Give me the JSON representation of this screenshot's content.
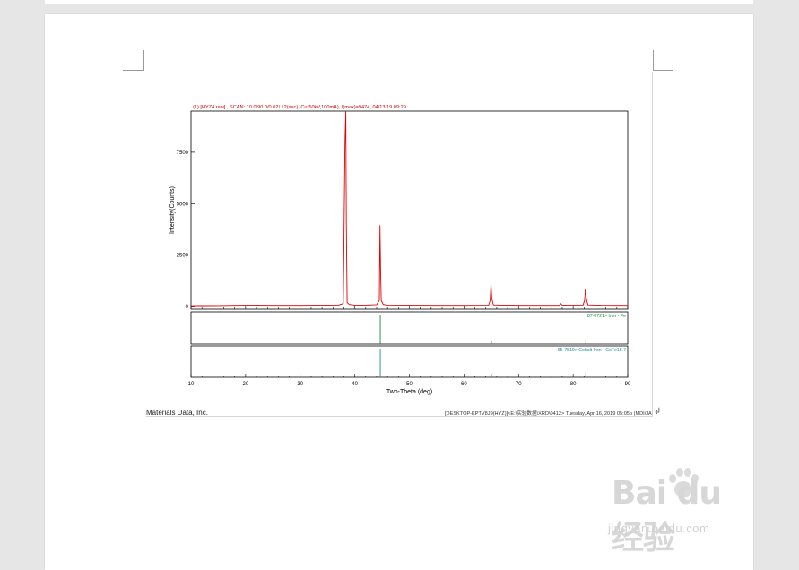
{
  "document": {
    "footer_left": "Materials Data, Inc.",
    "footer_right": "[DESKTOP-KPTV8J9(HYZ)]<E:\\实验数据\\XRD\\0412> Tuesday, Apr 16, 2019 05:05p (MDI/JA",
    "paragraph_mark": "↲"
  },
  "watermark": {
    "logo": "Bai du 经验",
    "url": "jingyan.baidu.com"
  },
  "chart_data": {
    "type": "line",
    "title": "(1) [HYZ4.raw] , SCAN: 10.0/90.0/0.02/.12(sec), Cu(50kV,100mA), I(max)=9474, 04/13/19 09:29",
    "xlabel": "Two-Theta (deg)",
    "ylabel": "Intensity(Counts)",
    "xlim": [
      10,
      90
    ],
    "ylim": [
      0,
      9500
    ],
    "xticks": [
      10,
      20,
      30,
      40,
      50,
      60,
      70,
      80,
      90
    ],
    "yticks": [
      0,
      2500,
      5000,
      7500
    ],
    "ytick_labels": [
      "0",
      "2500",
      "5000",
      "7500"
    ],
    "series": [
      {
        "color": "#e00000",
        "x": [
          10,
          12,
          15,
          18,
          20,
          22,
          25,
          28,
          30,
          33,
          35,
          37,
          37.9,
          38.2,
          38.35,
          38.45,
          38.6,
          39,
          40,
          42,
          44,
          44.5,
          44.62,
          44.72,
          44.85,
          45.2,
          46,
          50,
          55,
          60,
          64.5,
          64.8,
          64.95,
          65.1,
          65.4,
          68,
          72,
          75,
          77.5,
          77.7,
          78,
          81.8,
          82.1,
          82.25,
          82.4,
          82.7,
          85,
          88,
          90
        ],
        "y": [
          40,
          45,
          50,
          55,
          60,
          60,
          55,
          55,
          55,
          60,
          60,
          70,
          150,
          8000,
          9474,
          4000,
          200,
          100,
          70,
          70,
          90,
          300,
          3950,
          1800,
          300,
          100,
          70,
          60,
          55,
          55,
          60,
          300,
          1100,
          400,
          80,
          60,
          55,
          55,
          55,
          150,
          60,
          70,
          300,
          850,
          400,
          80,
          60,
          55,
          55
        ]
      }
    ],
    "reference_patterns": [
      {
        "label": "87-0721> Iron - Fe",
        "color": "#1a8a3a",
        "peaks": [
          {
            "x": 44.67,
            "rel": 100
          },
          {
            "x": 65.02,
            "rel": 12
          },
          {
            "x": 82.33,
            "rel": 18
          }
        ]
      },
      {
        "label": "65-7519> Cobalt Iron - CoFe15.7",
        "color": "#1a8a9a",
        "peaks": [
          {
            "x": 44.67,
            "rel": 100
          },
          {
            "x": 65.02,
            "rel": 12
          },
          {
            "x": 82.33,
            "rel": 20
          }
        ]
      }
    ]
  }
}
